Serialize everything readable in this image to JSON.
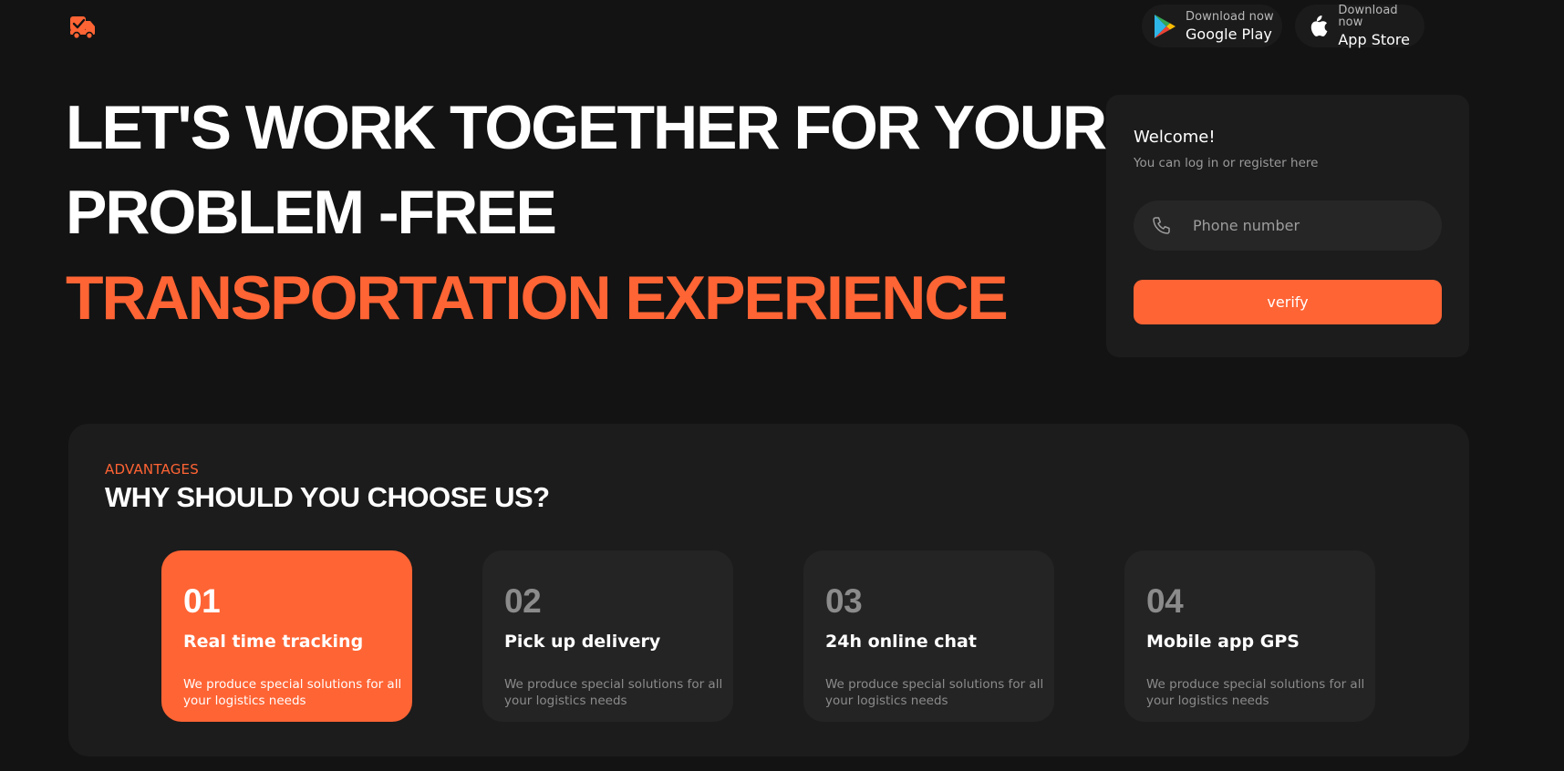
{
  "header": {
    "logo_icon": "delivery-truck-check-icon",
    "stores": [
      {
        "sub": "Download now",
        "name": "Google Play",
        "icon": "google-play-icon"
      },
      {
        "sub": "Download now",
        "name": "App Store",
        "icon": "apple-icon"
      }
    ]
  },
  "hero": {
    "line1": "LET'S WORK TOGETHER FOR YOUR",
    "line2": "PROBLEM -FREE",
    "line3": "TRANSPORTATION EXPERIENCE"
  },
  "login": {
    "title": "Welcome!",
    "subtitle": "You can log in or register here",
    "phone_placeholder": "Phone number",
    "phone_icon": "phone-icon",
    "verify_label": "verify"
  },
  "advantages": {
    "eyebrow": "ADVANTAGES",
    "title": "WHY SHOULD YOU CHOOSE US?",
    "cards": [
      {
        "num": "01",
        "title": "Real time tracking",
        "desc": "We produce special solutions for all your logistics needs",
        "active": true
      },
      {
        "num": "02",
        "title": "Pick up delivery",
        "desc": "We produce special solutions for all your logistics needs",
        "active": false
      },
      {
        "num": "03",
        "title": "24h online chat",
        "desc": "We produce special solutions for all your logistics needs",
        "active": false
      },
      {
        "num": "04",
        "title": "Mobile app GPS",
        "desc": "We produce special solutions for all your logistics needs",
        "active": false
      }
    ]
  },
  "colors": {
    "accent": "#ff6434",
    "background": "#131313",
    "panel": "#1c1c1c",
    "card": "#242424"
  }
}
